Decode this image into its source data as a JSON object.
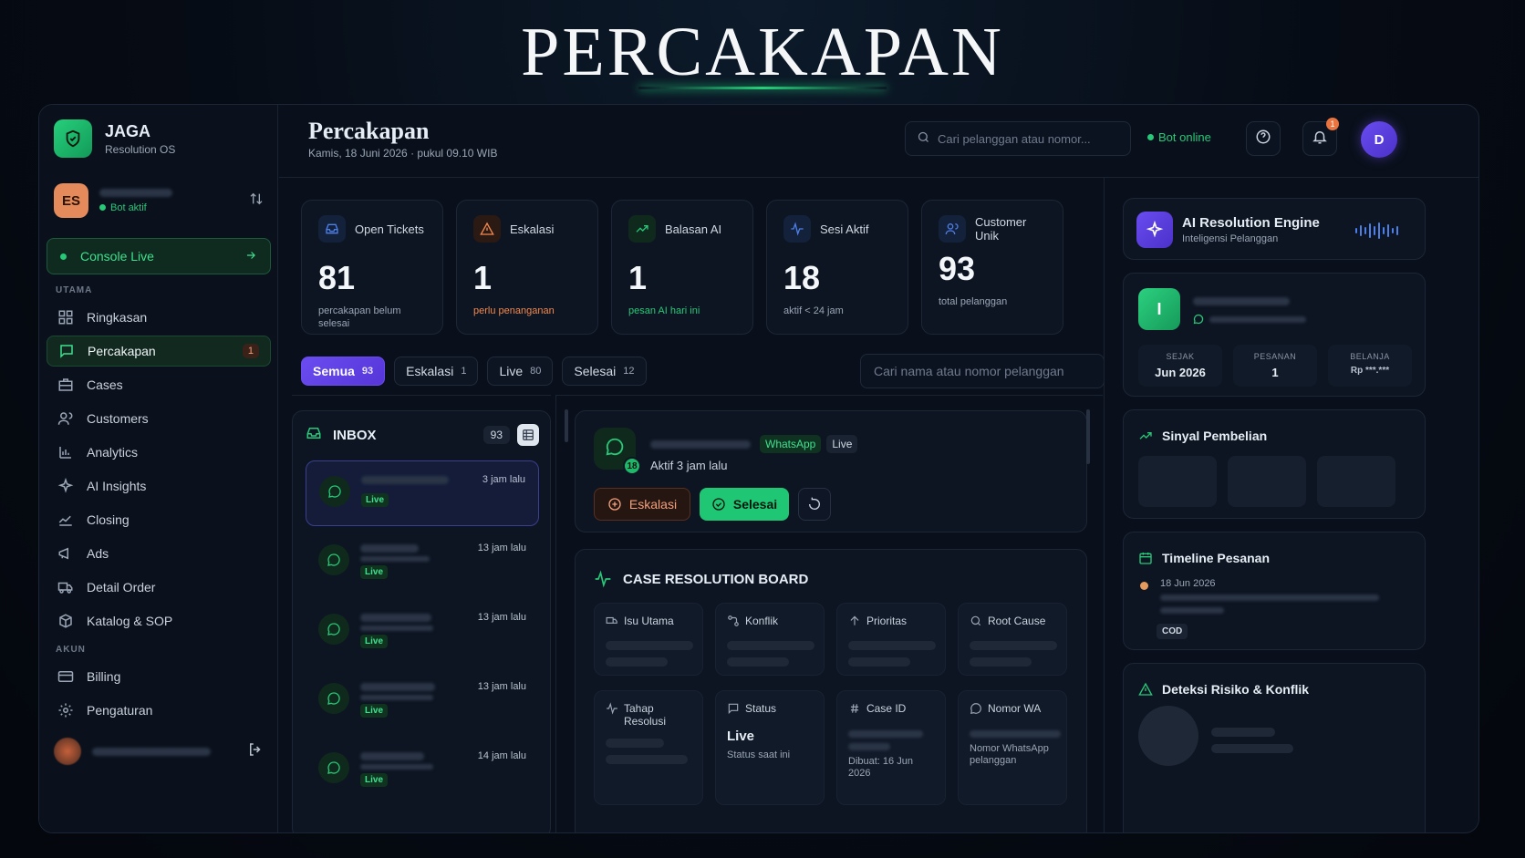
{
  "hero": {
    "title": "PERCAKAPAN"
  },
  "brand": {
    "name": "JAGA",
    "subtitle": "Resolution OS"
  },
  "user": {
    "initials": "ES",
    "status": "Bot aktif"
  },
  "console": {
    "label": "Console Live"
  },
  "sidebar": {
    "section_main": "UTAMA",
    "section_account": "AKUN",
    "items": [
      {
        "label": "Ringkasan",
        "icon": "grid-icon"
      },
      {
        "label": "Percakapan",
        "icon": "chat-icon",
        "badge": "1",
        "active": true
      },
      {
        "label": "Cases",
        "icon": "briefcase-icon"
      },
      {
        "label": "Customers",
        "icon": "users-icon"
      },
      {
        "label": "Analytics",
        "icon": "bar-chart-icon"
      },
      {
        "label": "AI Insights",
        "icon": "sparkle-icon"
      },
      {
        "label": "Closing",
        "icon": "trend-icon"
      },
      {
        "label": "Ads",
        "icon": "megaphone-icon"
      },
      {
        "label": "Detail Order",
        "icon": "truck-icon"
      },
      {
        "label": "Katalog & SOP",
        "icon": "box-icon"
      }
    ],
    "account_items": [
      {
        "label": "Billing",
        "icon": "card-icon"
      },
      {
        "label": "Pengaturan",
        "icon": "gear-icon"
      }
    ]
  },
  "header": {
    "title": "Percakapan",
    "subtitle": "Kamis, 18 Juni 2026 · pukul 09.10 WIB",
    "search_placeholder": "Cari pelanggan atau nomor...",
    "bot_status": "Bot online",
    "notif_count": "1",
    "avatar_initial": "D"
  },
  "stats": [
    {
      "label": "Open Tickets",
      "value": "81",
      "desc": "percakapan belum selesai",
      "color": "#4e7fe8"
    },
    {
      "label": "Eskalasi",
      "value": "1",
      "desc": "perlu penanganan",
      "color": "#f0894f"
    },
    {
      "label": "Balasan AI",
      "value": "1",
      "desc": "pesan AI hari ini",
      "color": "#27c878"
    },
    {
      "label": "Sesi Aktif",
      "value": "18",
      "desc": "aktif < 24 jam",
      "color": "#4e7fe8"
    },
    {
      "label": "Customer Unik",
      "value": "93",
      "desc": "total pelanggan",
      "color": "#4e7fe8"
    }
  ],
  "tabs": [
    {
      "label": "Semua",
      "count": "93"
    },
    {
      "label": "Eskalasi",
      "count": "1"
    },
    {
      "label": "Live",
      "count": "80"
    },
    {
      "label": "Selesai",
      "count": "12"
    }
  ],
  "search_name_placeholder": "Cari nama atau nomor pelanggan",
  "inbox": {
    "title": "INBOX",
    "count": "93",
    "items": [
      {
        "time": "3 jam lalu",
        "badge": "Live"
      },
      {
        "time": "13 jam lalu",
        "badge": "Live"
      },
      {
        "time": "13 jam lalu",
        "badge": "Live"
      },
      {
        "time": "13 jam lalu",
        "badge": "Live"
      },
      {
        "time": "14 jam lalu",
        "badge": "Live"
      }
    ]
  },
  "chat": {
    "avatar_count": "18",
    "channel": "WhatsApp",
    "state": "Live",
    "active_text": "Aktif 3 jam lalu",
    "btn_eskalasi": "Eskalasi",
    "btn_selesai": "Selesai"
  },
  "board": {
    "title": "CASE RESOLUTION BOARD",
    "row1": [
      {
        "label": "Isu Utama"
      },
      {
        "label": "Konflik"
      },
      {
        "label": "Prioritas"
      },
      {
        "label": "Root Cause"
      }
    ],
    "tahap": {
      "label": "Tahap Resolusi"
    },
    "status": {
      "label": "Status",
      "value": "Live",
      "note": "Status saat ini"
    },
    "case_id": {
      "label": "Case ID",
      "note": "Dibuat: 16 Jun 2026"
    },
    "nomor_wa": {
      "label": "Nomor WA",
      "note": "Nomor WhatsApp pelanggan"
    }
  },
  "ai_engine": {
    "title": "AI Resolution Engine",
    "subtitle": "Inteligensi Pelanggan"
  },
  "customer": {
    "initial": "I",
    "since_label": "SEJAK",
    "since_value": "Jun 2026",
    "orders_label": "PESANAN",
    "orders_value": "1",
    "spend_label": "BELANJA",
    "spend_value": "Rp ***.***"
  },
  "signals": {
    "title": "Sinyal Pembelian"
  },
  "timeline": {
    "title": "Timeline Pesanan",
    "date": "18 Jun 2026",
    "tag": "COD"
  },
  "risk": {
    "title": "Deteksi Risiko & Konflik"
  }
}
